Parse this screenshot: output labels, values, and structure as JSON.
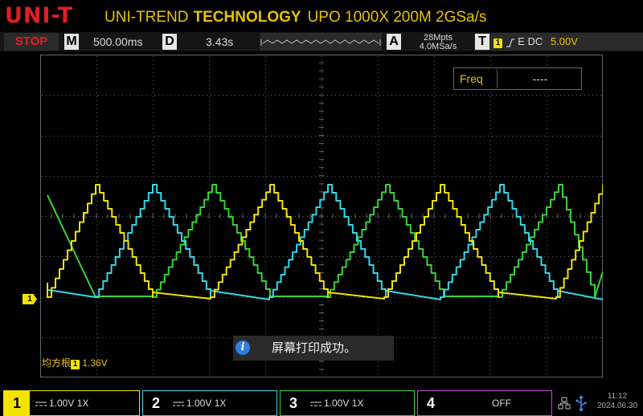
{
  "header": {
    "logo": "UNI-T",
    "brand_prefix": "UNI-TREND",
    "brand_bold": "TECHNOLOGY",
    "model": "UPO 1000X 200M 2GSa/s"
  },
  "status_bar": {
    "run_state": "STOP",
    "timebase_key": "M",
    "timebase_value": "500.00ms",
    "delay_key": "D",
    "delay_value": "3.43s",
    "acq_key": "A",
    "memory_depth": "28Mpts",
    "sample_rate": "4.0MSa/s",
    "trigger_key": "T",
    "trigger_source": "1",
    "trigger_mode": "E DC",
    "trigger_level": "5.00V"
  },
  "measurement": {
    "label": "Freq",
    "value": "----"
  },
  "ch1_marker": "1",
  "toast": {
    "icon": "i",
    "message": "屏幕打印成功。"
  },
  "rms": {
    "label": "均方根",
    "channel": "1",
    "value": "1.36V"
  },
  "channels": [
    {
      "number": "1",
      "scale": "1.00V",
      "probe": "1X",
      "color": "#f2e400"
    },
    {
      "number": "2",
      "scale": "1.00V",
      "probe": "1X",
      "color": "#35d7e8"
    },
    {
      "number": "3",
      "scale": "1.00V",
      "probe": "1X",
      "color": "#37d33a"
    },
    {
      "number": "4",
      "state": "OFF",
      "color": "#c84bd9"
    }
  ],
  "clock": {
    "time": "11:12",
    "date": "2024.06.30"
  },
  "colors": {
    "brand_red": "#e01f24",
    "accent_yellow": "#e8c200",
    "ch1": "#f2e400",
    "ch2": "#35d7e8",
    "ch3": "#37d33a",
    "ch4": "#c84bd9"
  }
}
